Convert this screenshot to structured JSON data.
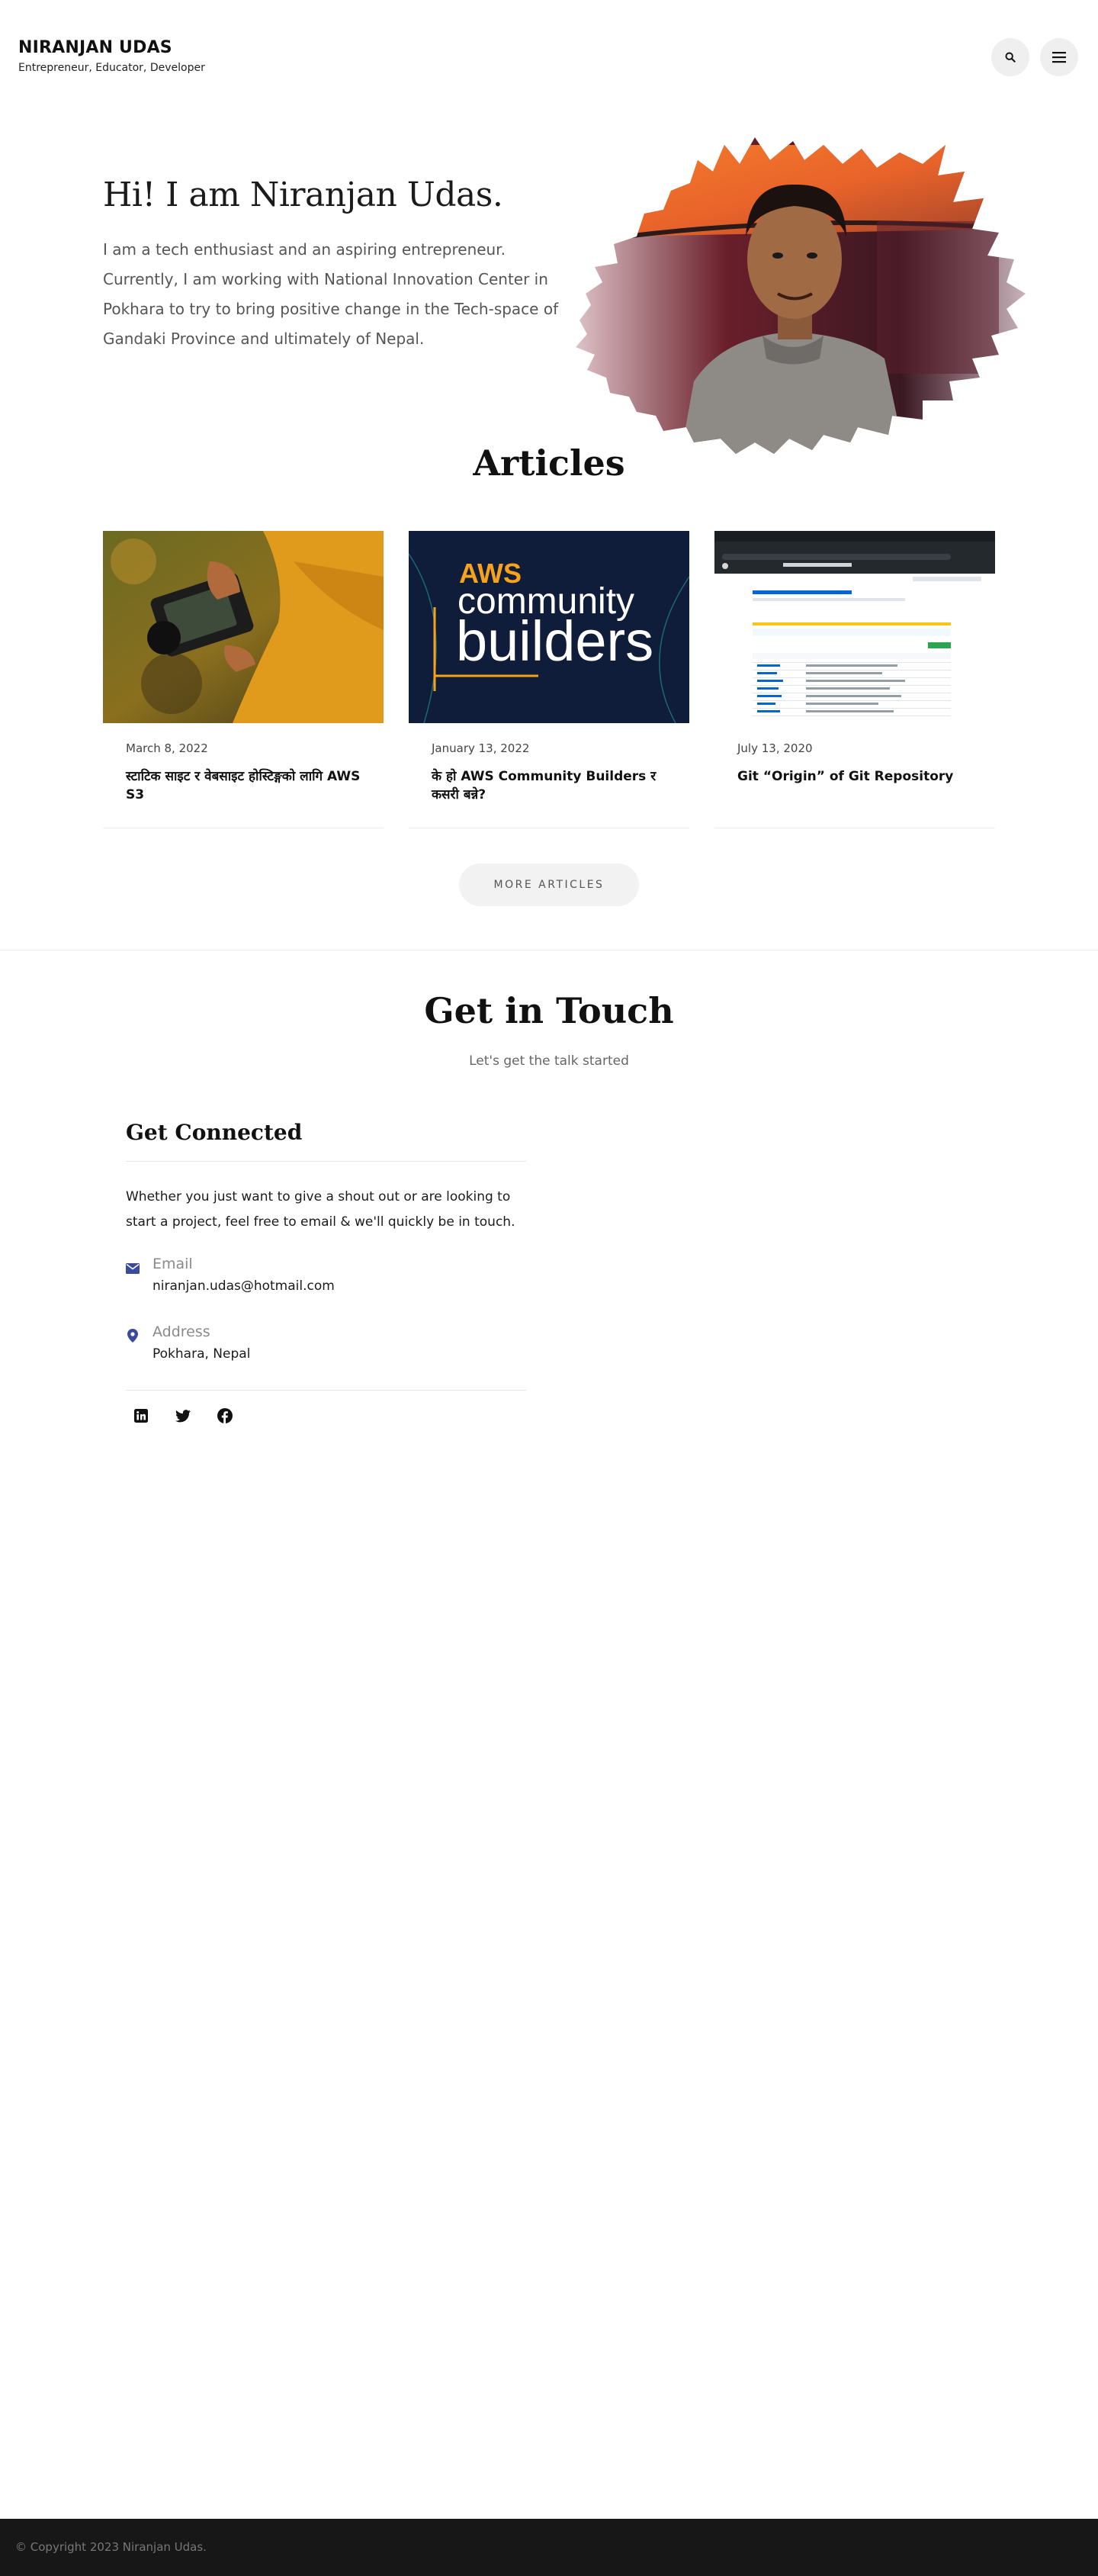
{
  "header": {
    "site_title": "NIRANJAN UDAS",
    "tagline": "Entrepreneur, Educator, Developer",
    "search_icon": "search-icon",
    "menu_icon": "menu-icon"
  },
  "hero": {
    "title": "Hi! I am Niranjan Udas.",
    "text": "I am a tech enthusiast and an aspiring entrepreneur. Currently, I am working with National Innovation Center in Pokhara to try to bring positive change in the Tech-space of Gandaki Province and ultimately of Nepal."
  },
  "articles": {
    "heading": "Articles",
    "items": [
      {
        "date": "March 8, 2022",
        "title": "स्टाटिक साइट र वेबसाइट होस्टिङ्गको लागि AWS S3",
        "image": "camera-photo"
      },
      {
        "date": "January 13, 2022",
        "title": "के हो AWS Community Builders र कसरी बन्ने?",
        "image": "aws-community-builders-banner"
      },
      {
        "date": "July 13, 2020",
        "title": "Git “Origin” of Git Repository",
        "image": "github-screenshot"
      }
    ],
    "banner": {
      "line1": "AWS",
      "line2": "community",
      "line3": "builders"
    },
    "more_button": "MORE ARTICLES"
  },
  "contact": {
    "heading": "Get in Touch",
    "subheading": "Let's get the talk started",
    "card_title": "Get Connected",
    "intro": "Whether you just want to give a shout out or are looking to start a project, feel free to email & we'll quickly be in touch.",
    "email_label": "Email",
    "email_value": "niranjan.udas@hotmail.com",
    "address_label": "Address",
    "address_value": "Pokhara, Nepal",
    "socials": [
      "linkedin-icon",
      "twitter-icon",
      "facebook-icon"
    ]
  },
  "colors": {
    "accent": "#3a4a9e",
    "aws_orange": "#f7a21b",
    "aws_navy": "#0f1d3a",
    "footer_bg": "#171717"
  },
  "footer": {
    "copyright": "© Copyright 2023 Niranjan Udas."
  }
}
